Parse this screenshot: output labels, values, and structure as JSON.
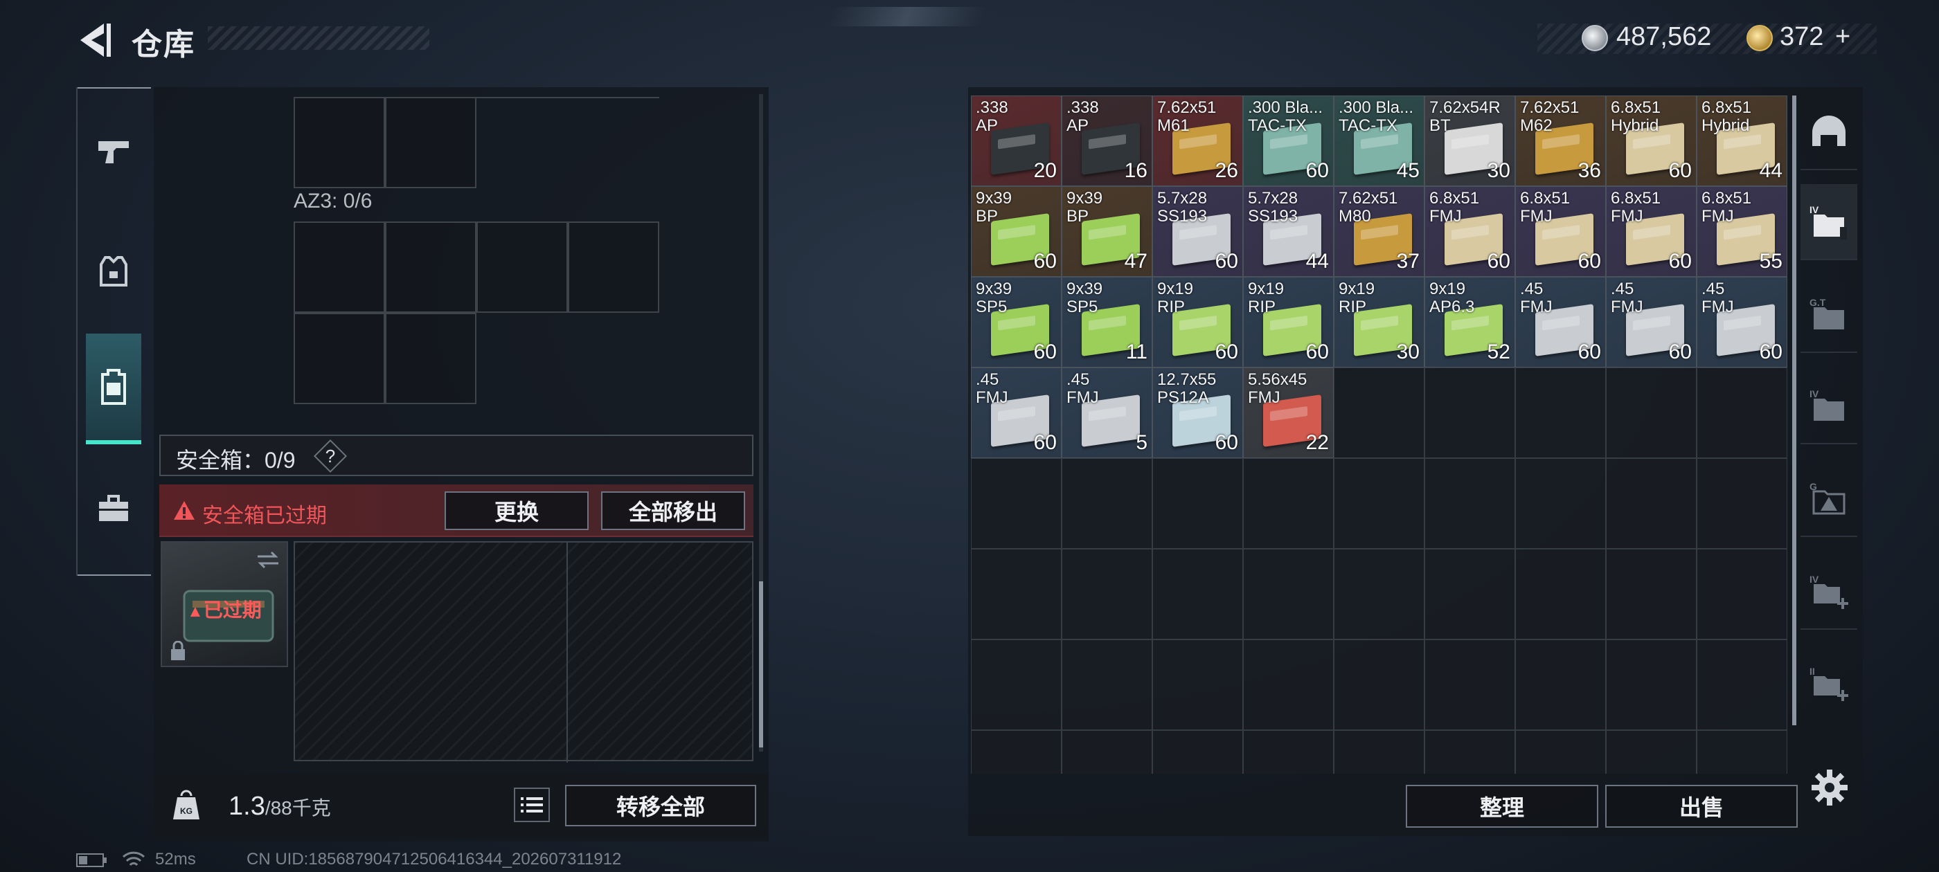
{
  "header": {
    "title": "仓库",
    "back_icon": "back-arrow-icon"
  },
  "currency": {
    "silver": "487,562",
    "gold": "372",
    "gold_add": "+"
  },
  "left": {
    "az3_label": "AZ3: 0/6",
    "safe_title": "安全箱：0/9",
    "safe_help": "?",
    "safe_warning": "安全箱已过期",
    "replace_btn": "更换",
    "move_all_out_btn": "全部移出",
    "safe_expired_label": "已过期",
    "weight_value": "1.3",
    "weight_max": "/88千克",
    "transfer_all_btn": "转移全部"
  },
  "status": {
    "ping": "52ms",
    "uid": "CN UID:185687904712506416344_202607311912"
  },
  "right": {
    "sort_btn": "整理",
    "sell_btn": "出售"
  },
  "items": [
    {
      "name": ".338\nAP",
      "count": "20",
      "bg": "#5a2b2e",
      "box": "#2f3538"
    },
    {
      "name": ".338\nAP",
      "count": "16",
      "bg": "#3a2a2e",
      "box": "#2f3538"
    },
    {
      "name": "7.62x51\nM61",
      "count": "26",
      "bg": "#5a2b2e",
      "box": "#c89a3e"
    },
    {
      "name": ".300 Bla...\nTAC-TX",
      "count": "60",
      "bg": "#2e4a4a",
      "box": "#7fb3a7"
    },
    {
      "name": ".300 Bla...\nTAC-TX",
      "count": "45",
      "bg": "#2e4a4a",
      "box": "#7fb3a7"
    },
    {
      "name": "7.62x54R\nBT",
      "count": "30",
      "bg": "#3a3d42",
      "box": "#d8d8d8"
    },
    {
      "name": "7.62x51\nM62",
      "count": "36",
      "bg": "#4a3a2a",
      "box": "#c89a3e"
    },
    {
      "name": "6.8x51\nHybrid",
      "count": "60",
      "bg": "#4a3a2a",
      "box": "#d8c9a0"
    },
    {
      "name": "6.8x51\nHybrid",
      "count": "44",
      "bg": "#4a3a2a",
      "box": "#d8c9a0"
    },
    {
      "name": "9x39\nBP",
      "count": "60",
      "bg": "#4a3a2a",
      "box": "#9bcf5a"
    },
    {
      "name": "9x39\nBP",
      "count": "47",
      "bg": "#4a3a2a",
      "box": "#9bcf5a"
    },
    {
      "name": "5.7x28\nSS193",
      "count": "60",
      "bg": "#3a3550",
      "box": "#c9ccd0"
    },
    {
      "name": "5.7x28\nSS193",
      "count": "44",
      "bg": "#3a3550",
      "box": "#c9ccd0"
    },
    {
      "name": "7.62x51\nM80",
      "count": "37",
      "bg": "#3a3550",
      "box": "#c89a3e"
    },
    {
      "name": "6.8x51\nFMJ",
      "count": "60",
      "bg": "#3a3550",
      "box": "#d8c9a0"
    },
    {
      "name": "6.8x51\nFMJ",
      "count": "60",
      "bg": "#3a3550",
      "box": "#d8c9a0"
    },
    {
      "name": "6.8x51\nFMJ",
      "count": "60",
      "bg": "#3a3550",
      "box": "#d8c9a0"
    },
    {
      "name": "6.8x51\nFMJ",
      "count": "55",
      "bg": "#3a3550",
      "box": "#d8c9a0"
    },
    {
      "name": "9x39\nSP5",
      "count": "60",
      "bg": "#2e3e50",
      "box": "#9bcf5a"
    },
    {
      "name": "9x39\nSP5",
      "count": "11",
      "bg": "#2e3e50",
      "box": "#9bcf5a"
    },
    {
      "name": "9x19\nRIP",
      "count": "60",
      "bg": "#2e3e50",
      "box": "#a9d46a"
    },
    {
      "name": "9x19\nRIP",
      "count": "60",
      "bg": "#2e3e50",
      "box": "#a9d46a"
    },
    {
      "name": "9x19\nRIP",
      "count": "30",
      "bg": "#2e3e50",
      "box": "#a9d46a"
    },
    {
      "name": "9x19\nAP6.3",
      "count": "52",
      "bg": "#2e3e50",
      "box": "#a9d46a"
    },
    {
      "name": ".45\nFMJ",
      "count": "60",
      "bg": "#2e3e50",
      "box": "#c9ccd0"
    },
    {
      "name": ".45\nFMJ",
      "count": "60",
      "bg": "#2e3e50",
      "box": "#c9ccd0"
    },
    {
      "name": ".45\nFMJ",
      "count": "60",
      "bg": "#2e3e50",
      "box": "#c9ccd0"
    },
    {
      "name": ".45\nFMJ",
      "count": "60",
      "bg": "#2e3e50",
      "box": "#c9ccd0"
    },
    {
      "name": ".45\nFMJ",
      "count": "5",
      "bg": "#2e3e50",
      "box": "#c9ccd0"
    },
    {
      "name": "12.7x55\nPS12A",
      "count": "60",
      "bg": "#2e3e50",
      "box": "#bcd3dc"
    },
    {
      "name": "5.56x45\nFMJ",
      "count": "22",
      "bg": "#3a3d42",
      "box": "#d25a4e"
    }
  ]
}
